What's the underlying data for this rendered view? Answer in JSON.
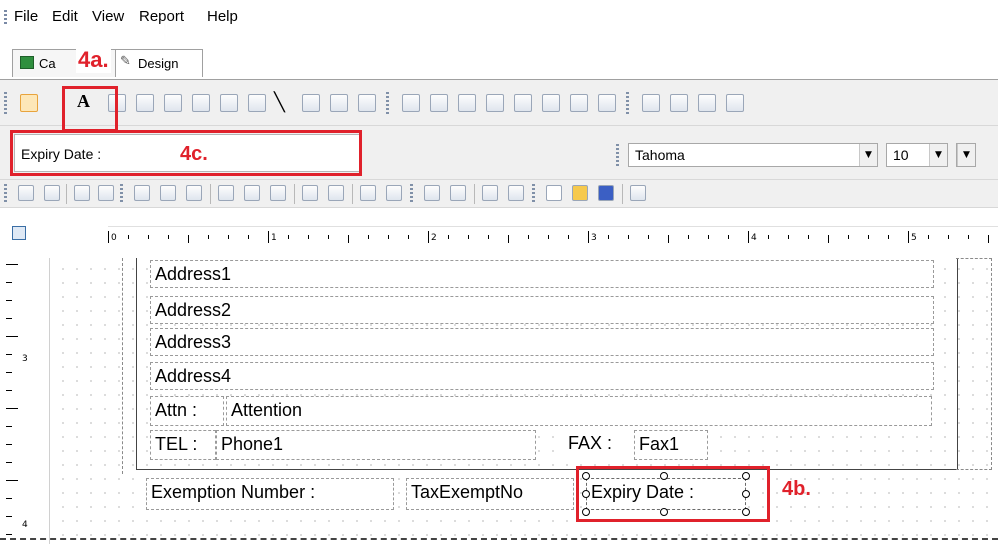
{
  "menu": {
    "file": "File",
    "edit": "Edit",
    "view": "View",
    "report": "Report",
    "help": "Help"
  },
  "tabs": {
    "code": "Ca",
    "design": "Design"
  },
  "toolbar": {
    "label_tool_glyph": "A",
    "object_name": "Expiry Date :",
    "font_name": "Tahoma",
    "font_size": "10"
  },
  "ruler": {
    "marks": [
      "0",
      "1",
      "2",
      "3",
      "4",
      "5"
    ],
    "vertical_marks": [
      "3",
      "4"
    ]
  },
  "report": {
    "address1": "Address1",
    "address2": "Address2",
    "address3": "Address3",
    "address4": "Address4",
    "attn_label": "Attn :",
    "attn_value": "Attention",
    "tel_label": "TEL :",
    "tel_value": "Phone1",
    "fax_label": "FAX :",
    "fax_value": "Fax1",
    "exemption_label": "Exemption Number :",
    "exemption_value": "TaxExemptNo",
    "expiry_label": "Expiry Date :"
  },
  "annotations": {
    "a": "4a.",
    "b": "4b.",
    "c": "4c.",
    "color": "#e0212b"
  }
}
